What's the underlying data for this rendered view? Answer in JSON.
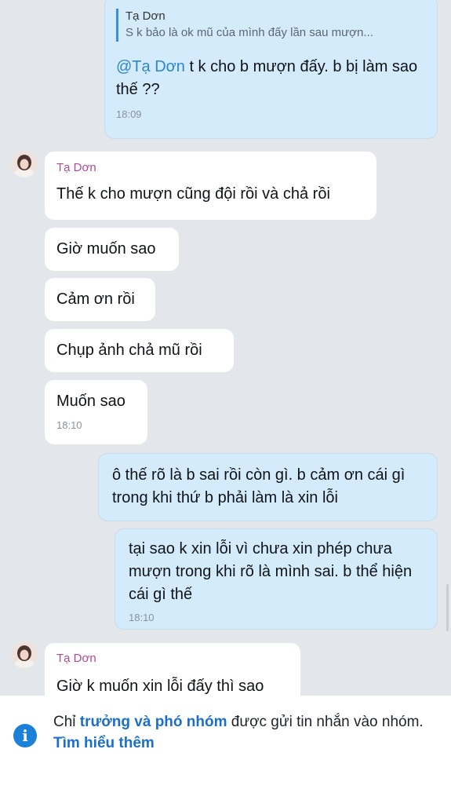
{
  "messages": [
    {
      "direction": "out",
      "reply_to": {
        "name": "Tạ Dơn",
        "text": "S k bảo là ok mũ của mình đấy lần sau mượn..."
      },
      "mention": "@Tạ Dơn",
      "text": " t k cho b mượn đấy. b bị làm sao thế ??",
      "time": "18:09"
    },
    {
      "direction": "in",
      "sender": "Tạ Dơn",
      "text": "Thế k cho mượn cũng đội rồi và chả rồi"
    },
    {
      "direction": "in",
      "text": "Giờ muốn sao"
    },
    {
      "direction": "in",
      "text": "Cảm ơn rồi"
    },
    {
      "direction": "in",
      "text": "Chụp ảnh chả mũ rồi"
    },
    {
      "direction": "in",
      "text": "Muốn sao",
      "time": "18:10"
    },
    {
      "direction": "out",
      "text": "ô thế rõ là b sai rồi còn gì. b cảm ơn cái gì trong khi thứ b phải làm là xin lỗi"
    },
    {
      "direction": "out",
      "text": "tại sao k xin lỗi vì chưa xin phép chưa mượn trong khi rõ là mình sai. b thể hiện cái gì thế",
      "time": "18:10"
    },
    {
      "direction": "in",
      "sender": "Tạ Dơn",
      "text": "Giờ k muốn xin lỗi đấy thì sao"
    }
  ],
  "footer": {
    "prefix": "Chỉ ",
    "role_link": "trưởng và phó nhóm",
    "middle": " được gửi tin nhắn vào nhóm. ",
    "learn_more": "Tìm hiểu thêm"
  },
  "colors": {
    "outgoing_bubble": "#d4ebfb",
    "incoming_bubble": "#ffffff",
    "sender_name": "#b24a8f",
    "accent": "#1c7fd8"
  },
  "icons": {
    "info": "info-icon",
    "avatar": "avatar"
  }
}
